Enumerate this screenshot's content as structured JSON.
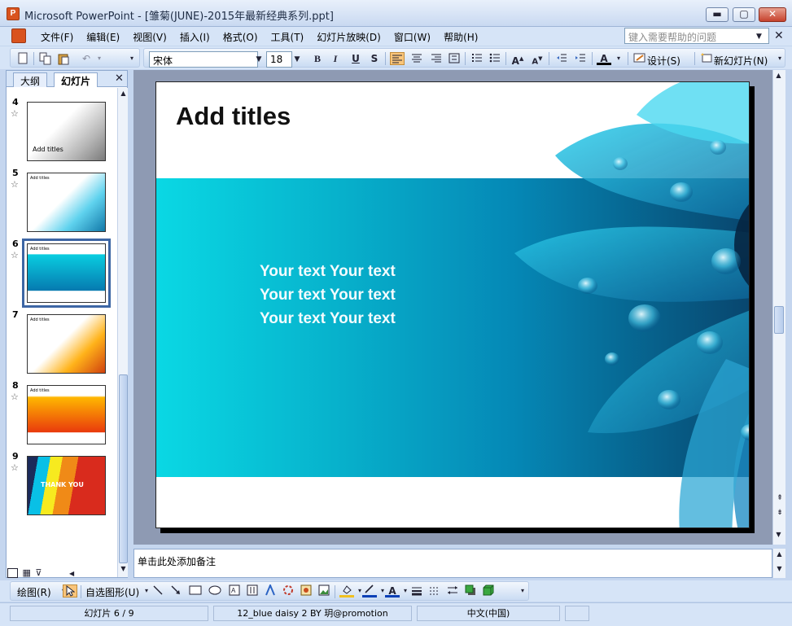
{
  "window": {
    "title": "Microsoft PowerPoint - [雏菊(JUNE)-2015年最新经典系列.ppt]",
    "app_icon": "powerpoint-icon",
    "buttons": {
      "minimize": "▬",
      "maximize": "▢",
      "close": "✕"
    }
  },
  "menubar": {
    "items": [
      "文件(F)",
      "编辑(E)",
      "视图(V)",
      "插入(I)",
      "格式(O)",
      "工具(T)",
      "幻灯片放映(D)",
      "窗口(W)",
      "帮助(H)"
    ],
    "help_placeholder": "键入需要帮助的问题",
    "help_arrow": "▼",
    "doc_close": "✕"
  },
  "toolbar": {
    "font_name": "宋体",
    "font_size": "18",
    "design_label": "设计(S)",
    "new_slide_label": "新幻灯片(N)",
    "bold": "B",
    "italic": "I",
    "underline": "U",
    "shadow": "S",
    "font_color_letter": "A"
  },
  "pane": {
    "tabs": [
      "大纲",
      "幻灯片"
    ],
    "active_tab": 1,
    "close": "✕",
    "thumbnails": [
      {
        "num": "4",
        "title": "Add titles",
        "style": "gray"
      },
      {
        "num": "5",
        "title": "Add titles",
        "style": "blue"
      },
      {
        "num": "6",
        "title": "Add titles",
        "style": "blue-band",
        "selected": true
      },
      {
        "num": "7",
        "title": "Add titles",
        "style": "orange"
      },
      {
        "num": "8",
        "title": "Add titles",
        "style": "red-band"
      },
      {
        "num": "9",
        "title": "THANK YOU",
        "style": "stripes"
      }
    ]
  },
  "slide": {
    "title": "Add titles",
    "body_lines": [
      "Your text Your text",
      "Your text Your text",
      "Your text Your text"
    ]
  },
  "notes": {
    "placeholder": "单击此处添加备注"
  },
  "drawbar": {
    "draw_label": "绘图(R)",
    "autoshapes_label": "自选图形(U)"
  },
  "status": {
    "slide_position": "幻灯片 6 / 9",
    "design_name": "12_blue daisy 2 BY 玥@promotion",
    "language": "中文(中国)"
  },
  "colors": {
    "accent": "#3d66a4",
    "band_left": "#0ad8e4",
    "band_right": "#08466e",
    "toolbar_bg": "#d6e4f7"
  }
}
